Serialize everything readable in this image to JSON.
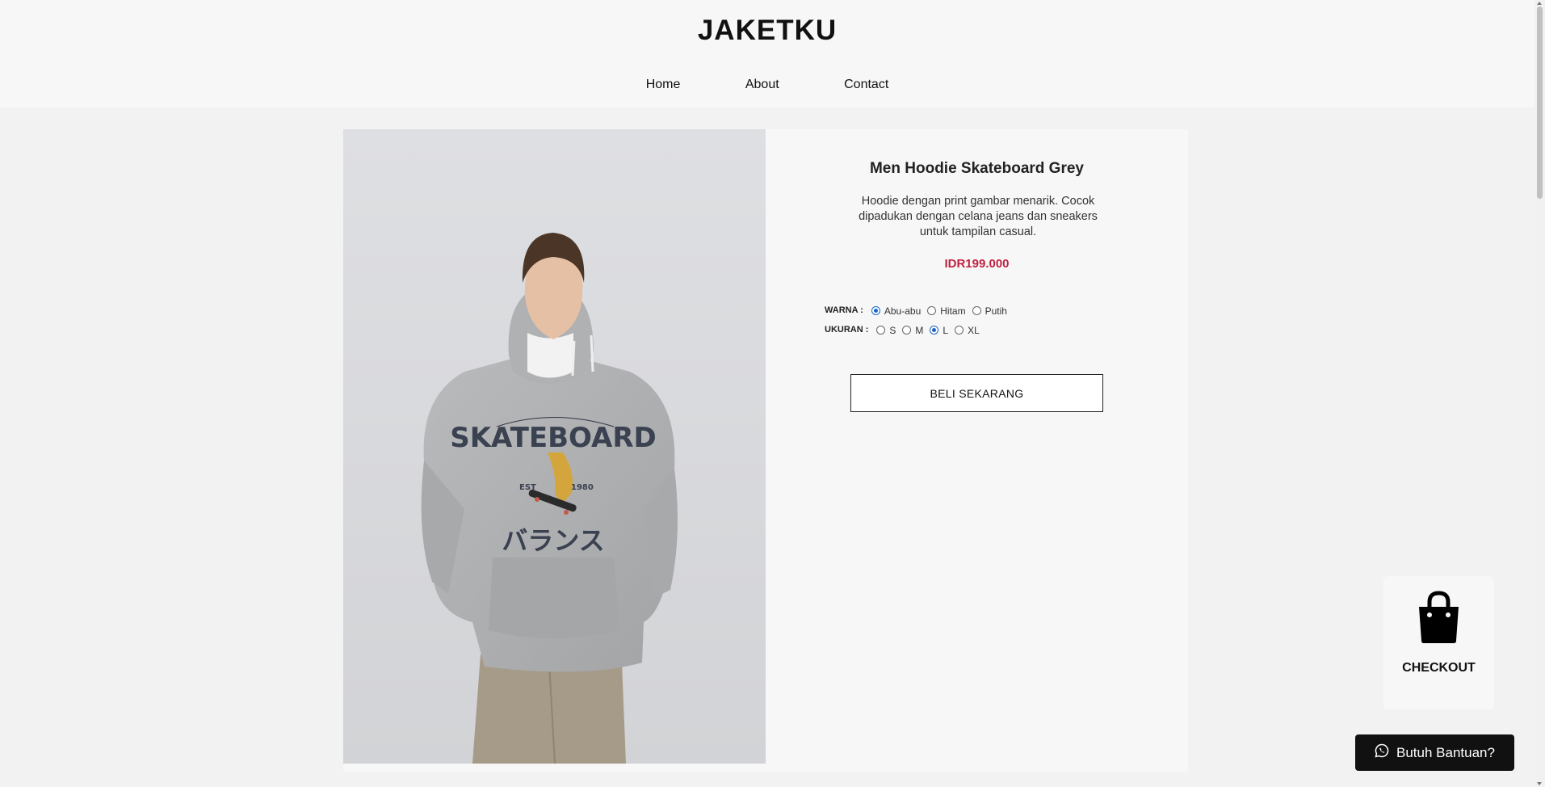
{
  "brand": "JAKETKU",
  "nav": {
    "home": "Home",
    "about": "About",
    "contact": "Contact"
  },
  "product": {
    "title": "Men Hoodie Skateboard Grey",
    "description": "Hoodie dengan print gambar menarik. Cocok dipadukan dengan celana jeans dan sneakers untuk tampilan casual.",
    "price": "IDR199.000",
    "image_print": {
      "top": "SKATEBOARD",
      "left": "EST",
      "right": "1980",
      "bottom": "バランス"
    },
    "warna": {
      "label": "WARNA :",
      "options": [
        "Abu-abu",
        "Hitam",
        "Putih"
      ],
      "selected": "Abu-abu"
    },
    "ukuran": {
      "label": "UKURAN :",
      "options": [
        "S",
        "M",
        "L",
        "XL"
      ],
      "selected": "L"
    },
    "buy_label": "BELI SEKARANG"
  },
  "checkout": {
    "label": "CHECKOUT",
    "icon": "shopping-bag-icon"
  },
  "help": {
    "label": "Butuh Bantuan?",
    "icon": "whatsapp-icon"
  },
  "colors": {
    "price": "#c0213f",
    "radio_selected": "#1a66c7",
    "button_dark": "#111111"
  }
}
